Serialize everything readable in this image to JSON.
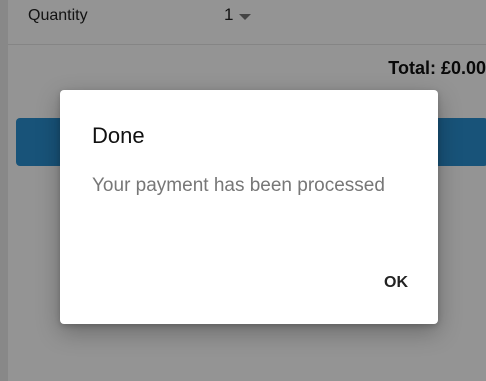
{
  "quantity": {
    "label": "Quantity",
    "selected_value": "1"
  },
  "total": {
    "text": "Total: £0.00"
  },
  "dialog": {
    "title": "Done",
    "message": "Your payment has been processed",
    "ok_label": "OK"
  },
  "colors": {
    "primary_button": "#2a8fd0",
    "scrim": "rgba(0,0,0,0.42)"
  },
  "icons": {
    "quantity_dropdown": "caret-down-icon"
  }
}
